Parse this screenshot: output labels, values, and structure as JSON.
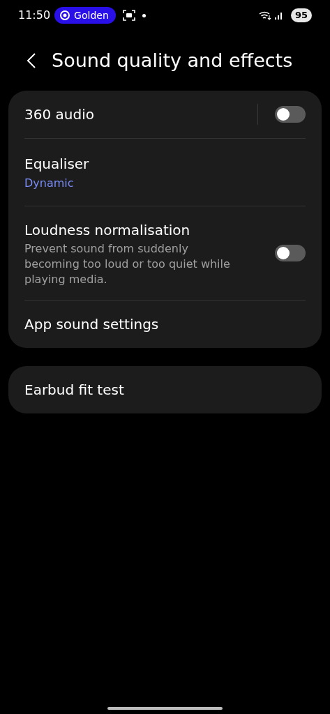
{
  "status_bar": {
    "time": "11:50",
    "pill": "Golden",
    "battery": "95"
  },
  "header": {
    "title": "Sound quality and effects"
  },
  "groups": [
    {
      "items": [
        {
          "kind": "switch",
          "title": "360 audio",
          "on": false,
          "divider": true
        },
        {
          "kind": "value",
          "title": "Equaliser",
          "value": "Dynamic"
        },
        {
          "kind": "switch",
          "title": "Loudness normalisation",
          "summary": "Prevent sound from suddenly becoming too loud or too quiet while playing media.",
          "on": false,
          "divider": false
        },
        {
          "kind": "plain",
          "title": "App sound settings"
        }
      ]
    },
    {
      "items": [
        {
          "kind": "plain",
          "title": "Earbud fit test"
        }
      ]
    }
  ]
}
